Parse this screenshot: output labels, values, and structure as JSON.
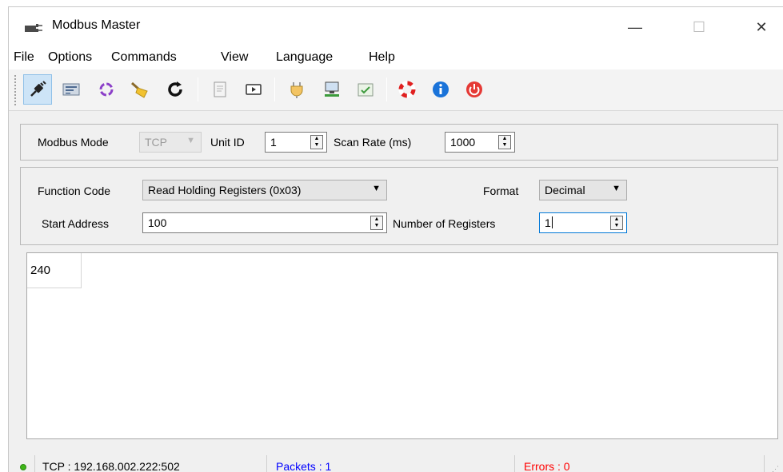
{
  "window": {
    "title": "Modbus Master",
    "controls": {
      "minimize": "—",
      "maximize": "☐",
      "close": "✕"
    }
  },
  "menu": [
    "File",
    "Options",
    "Commands",
    "View",
    "Language",
    "Help"
  ],
  "toolbar": {
    "buttons": [
      {
        "icon": "connect-plug-icon",
        "active": true
      },
      {
        "icon": "serial-settings-icon"
      },
      {
        "icon": "scan-cycle-icon"
      },
      {
        "icon": "clear-broom-icon"
      },
      {
        "icon": "reset-counters-icon"
      },
      {
        "icon": "log-document-icon"
      },
      {
        "icon": "bus-monitor-icon"
      },
      {
        "icon": "plug-settings-icon"
      },
      {
        "icon": "tcp-network-icon"
      },
      {
        "icon": "checkmark-window-icon"
      },
      {
        "icon": "help-lifebuoy-icon"
      },
      {
        "icon": "info-icon"
      },
      {
        "icon": "exit-power-icon"
      }
    ]
  },
  "settings": {
    "modbus_mode_label": "Modbus Mode",
    "modbus_mode_value": "TCP",
    "unit_id_label": "Unit ID",
    "unit_id_value": "1",
    "scan_rate_label": "Scan Rate (ms)",
    "scan_rate_value": "1000"
  },
  "request": {
    "function_code_label": "Function Code",
    "function_code_value": "Read Holding Registers (0x03)",
    "format_label": "Format",
    "format_value": "Decimal",
    "start_address_label": "Start Address",
    "start_address_value": "100",
    "num_registers_label": "Number of Registers",
    "num_registers_value": "1"
  },
  "data": {
    "registers": [
      "240"
    ]
  },
  "status": {
    "connection": "TCP : 192.168.002.222:502",
    "packets": "Packets : 1",
    "errors": "Errors : 0",
    "packets_color": "#0000ff",
    "errors_color": "#ff0000",
    "led_color": "#3fb618"
  }
}
